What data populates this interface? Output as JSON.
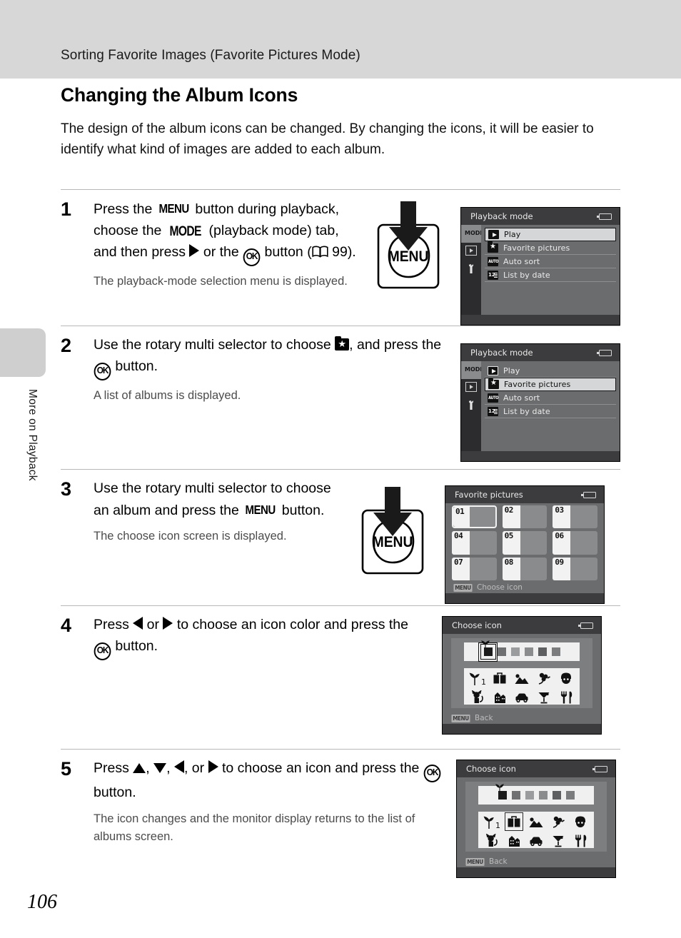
{
  "header": {
    "running_head": "Sorting Favorite Images (Favorite Pictures Mode)"
  },
  "sidebar": {
    "chapter_label": "More on Playback"
  },
  "page": {
    "number": "106",
    "section_title": "Changing the Album Icons",
    "intro": "The design of the album icons can be changed. By changing the icons, it will be easier to identify what kind of images are added to each album."
  },
  "steps": [
    {
      "number": "1",
      "main_parts": {
        "p1": "Press the ",
        "menu": "MENU",
        "p2": " button during playback, choose the ",
        "mode": "MODE",
        "p3": " (playback mode) tab, and then press ",
        "p4": " or the ",
        "ok": "OK",
        "p5": " button (",
        "page_ref": "99",
        "p6": ").",
        "close": ")"
      },
      "sub": "The playback-mode selection menu is displayed.",
      "aside": "menu-button-illustration"
    },
    {
      "number": "2",
      "main_parts": {
        "p1": "Use the rotary multi selector to choose ",
        "p2": ", and press the ",
        "ok": "OK",
        "p3": " button."
      },
      "sub": "A list of albums is displayed.",
      "aside": "none"
    },
    {
      "number": "3",
      "main_parts": {
        "p1": "Use the rotary multi selector to choose an album and press the ",
        "menu": "MENU",
        "p2": " button."
      },
      "sub": "The choose icon screen is displayed.",
      "aside": "menu-button-illustration"
    },
    {
      "number": "4",
      "main_parts": {
        "p1": "Press ",
        "p2": " or ",
        "p3": " to choose an icon color and press the ",
        "ok": "OK",
        "p4": " button."
      },
      "sub": "",
      "aside": "none"
    },
    {
      "number": "5",
      "main_parts": {
        "p1": "Press ",
        "p2": ", ",
        "p3": ", ",
        "p4": ", or ",
        "p5": " to choose an icon and press the ",
        "ok": "OK",
        "p6": " button."
      },
      "sub": "The icon changes and the monitor display returns to the list of albums screen.",
      "aside": "none"
    }
  ],
  "menu_button_illustration": {
    "label": "MENU"
  },
  "screens": {
    "playback_mode_1": {
      "title": "Playback mode",
      "tabs": [
        {
          "name": "MODE",
          "label": "MODE",
          "active": true
        },
        {
          "name": "playback",
          "label": "",
          "active": false
        },
        {
          "name": "setup",
          "label": "",
          "active": false
        }
      ],
      "items": [
        {
          "icon": "play-icon",
          "label": "Play",
          "selected": true
        },
        {
          "icon": "favorite-pictures-icon",
          "label": "Favorite pictures",
          "selected": false
        },
        {
          "icon": "auto-sort-icon",
          "label": "Auto sort",
          "selected": false
        },
        {
          "icon": "list-by-date-icon",
          "label": "List by date",
          "selected": false
        }
      ]
    },
    "playback_mode_2": {
      "title": "Playback mode",
      "tabs": [
        {
          "name": "MODE",
          "label": "MODE",
          "active": true
        },
        {
          "name": "playback",
          "label": "",
          "active": false
        },
        {
          "name": "setup",
          "label": "",
          "active": false
        }
      ],
      "items": [
        {
          "icon": "play-icon",
          "label": "Play",
          "selected": false
        },
        {
          "icon": "favorite-pictures-icon",
          "label": "Favorite pictures",
          "selected": true
        },
        {
          "icon": "auto-sort-icon",
          "label": "Auto sort",
          "selected": false
        },
        {
          "icon": "list-by-date-icon",
          "label": "List by date",
          "selected": false
        }
      ]
    },
    "favorite_pictures": {
      "title": "Favorite pictures",
      "albums": [
        {
          "number": "01",
          "selected": true
        },
        {
          "number": "02",
          "selected": false
        },
        {
          "number": "03",
          "selected": false
        },
        {
          "number": "04",
          "selected": false
        },
        {
          "number": "05",
          "selected": false
        },
        {
          "number": "06",
          "selected": false
        },
        {
          "number": "07",
          "selected": false
        },
        {
          "number": "08",
          "selected": false
        },
        {
          "number": "09",
          "selected": false
        }
      ],
      "hint_tag": "MENU",
      "hint_text": "Choose icon"
    },
    "choose_icon_4": {
      "title": "Choose icon",
      "swatches": [
        {
          "color": "#1b1b1b",
          "selected": true
        },
        {
          "color": "#6e7072",
          "selected": false
        },
        {
          "color": "#9a9c9e",
          "selected": false
        },
        {
          "color": "#8a8c8e",
          "selected": false
        },
        {
          "color": "#5d5f61",
          "selected": false
        },
        {
          "color": "#7a7c7e",
          "selected": false
        }
      ],
      "icons": [
        {
          "name": "sprout-one-icon",
          "selected": false
        },
        {
          "name": "suitcase-icon",
          "selected": false
        },
        {
          "name": "mountain-icon",
          "selected": false
        },
        {
          "name": "flower-icon",
          "selected": false
        },
        {
          "name": "person-icon",
          "selected": false
        },
        {
          "name": "cat-icon",
          "selected": false
        },
        {
          "name": "buildings-icon",
          "selected": false
        },
        {
          "name": "car-icon",
          "selected": false
        },
        {
          "name": "cocktail-icon",
          "selected": false
        },
        {
          "name": "cutlery-icon",
          "selected": false
        }
      ],
      "selection_target": "swatch",
      "hint_tag": "MENU",
      "hint_text": "Back"
    },
    "choose_icon_5": {
      "title": "Choose icon",
      "swatches": [
        {
          "color": "#1b1b1b",
          "selected": false
        },
        {
          "color": "#6e7072",
          "selected": false
        },
        {
          "color": "#9a9c9e",
          "selected": false
        },
        {
          "color": "#8a8c8e",
          "selected": false
        },
        {
          "color": "#5d5f61",
          "selected": false
        },
        {
          "color": "#7a7c7e",
          "selected": false
        }
      ],
      "icons": [
        {
          "name": "sprout-one-icon",
          "selected": false
        },
        {
          "name": "suitcase-icon",
          "selected": true
        },
        {
          "name": "mountain-icon",
          "selected": false
        },
        {
          "name": "flower-icon",
          "selected": false
        },
        {
          "name": "person-icon",
          "selected": false
        },
        {
          "name": "cat-icon",
          "selected": false
        },
        {
          "name": "buildings-icon",
          "selected": false
        },
        {
          "name": "car-icon",
          "selected": false
        },
        {
          "name": "cocktail-icon",
          "selected": false
        },
        {
          "name": "cutlery-icon",
          "selected": false
        }
      ],
      "selection_target": "icon",
      "hint_tag": "MENU",
      "hint_text": "Back"
    }
  }
}
